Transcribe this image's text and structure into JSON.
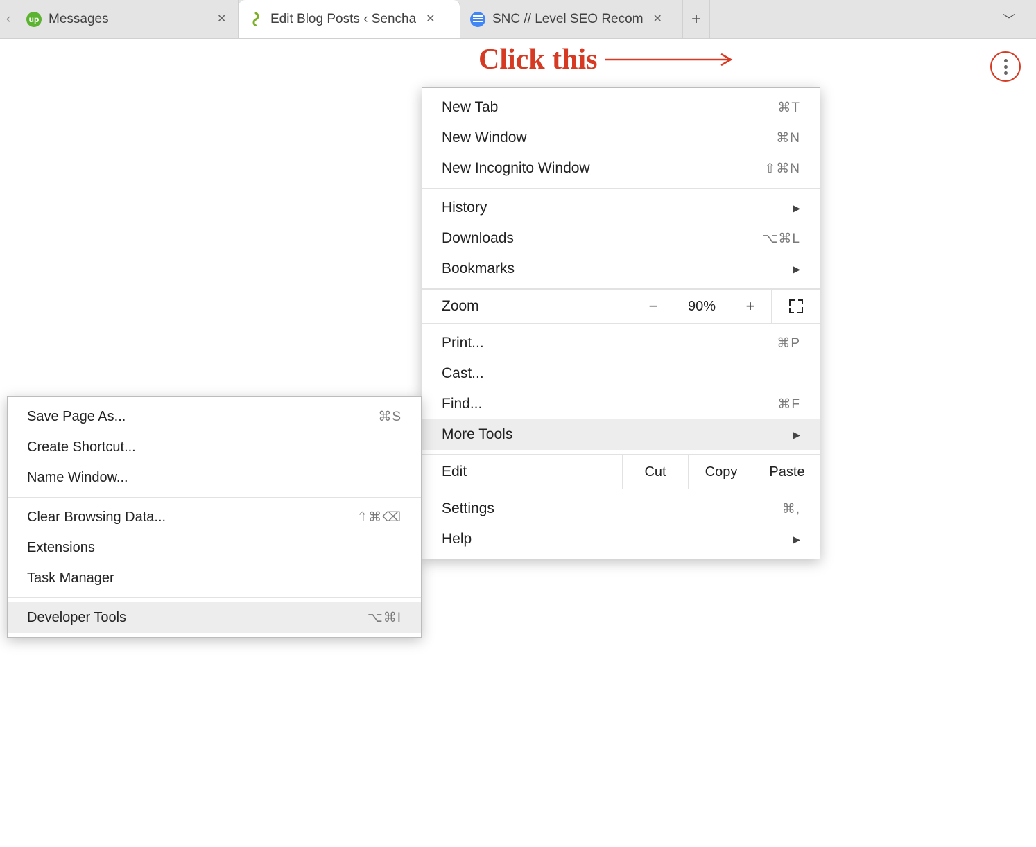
{
  "tabs": {
    "items": [
      {
        "title": "Messages"
      },
      {
        "title": "Edit Blog Posts ‹ Sencha"
      },
      {
        "title": "SNC // Level SEO Recom"
      }
    ]
  },
  "annotation": {
    "text": "Click this"
  },
  "menu": {
    "new_tab": {
      "label": "New Tab",
      "shortcut": "⌘T"
    },
    "new_window": {
      "label": "New Window",
      "shortcut": "⌘N"
    },
    "new_incognito": {
      "label": "New Incognito Window",
      "shortcut": "⇧⌘N"
    },
    "history": {
      "label": "History"
    },
    "downloads": {
      "label": "Downloads",
      "shortcut": "⌥⌘L"
    },
    "bookmarks": {
      "label": "Bookmarks"
    },
    "zoom": {
      "label": "Zoom",
      "value": "90%",
      "minus": "−",
      "plus": "+"
    },
    "print": {
      "label": "Print...",
      "shortcut": "⌘P"
    },
    "cast": {
      "label": "Cast..."
    },
    "find": {
      "label": "Find...",
      "shortcut": "⌘F"
    },
    "more_tools": {
      "label": "More Tools"
    },
    "edit": {
      "label": "Edit",
      "cut": "Cut",
      "copy": "Copy",
      "paste": "Paste"
    },
    "settings": {
      "label": "Settings",
      "shortcut": "⌘,"
    },
    "help": {
      "label": "Help"
    }
  },
  "submenu": {
    "save_page": {
      "label": "Save Page As...",
      "shortcut": "⌘S"
    },
    "create_shortcut": {
      "label": "Create Shortcut..."
    },
    "name_window": {
      "label": "Name Window..."
    },
    "clear_data": {
      "label": "Clear Browsing Data...",
      "shortcut": "⇧⌘⌫"
    },
    "extensions": {
      "label": "Extensions"
    },
    "task_manager": {
      "label": "Task Manager"
    },
    "dev_tools": {
      "label": "Developer Tools",
      "shortcut": "⌥⌘I"
    }
  }
}
